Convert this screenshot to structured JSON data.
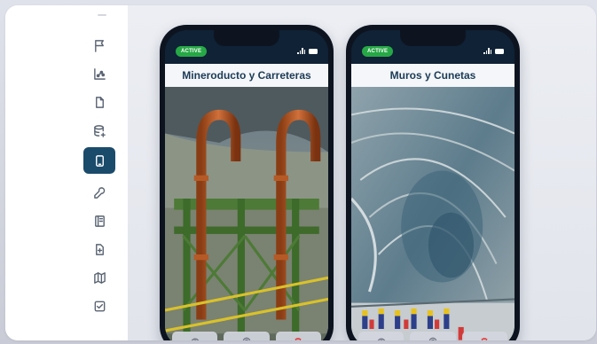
{
  "sidebar": {
    "items": [
      {
        "name": "flag-icon",
        "active": false
      },
      {
        "name": "chart-icon",
        "active": false
      },
      {
        "name": "document-icon",
        "active": false
      },
      {
        "name": "database-add-icon",
        "active": false
      },
      {
        "name": "mobile-icon",
        "active": true
      },
      {
        "name": "wrench-icon",
        "active": false
      },
      {
        "name": "book-icon",
        "active": false
      },
      {
        "name": "file-add-icon",
        "active": false
      },
      {
        "name": "map-icon",
        "active": false
      },
      {
        "name": "checkbox-icon",
        "active": false
      }
    ]
  },
  "phones": [
    {
      "badge": "ACTIVE",
      "title": "Mineroducto y Carreteras",
      "image": "industrial-pipes-photo",
      "actions": [
        "view-icon",
        "settings-icon",
        "delete-icon"
      ]
    },
    {
      "badge": "ACTIVE",
      "title": "Muros y Cunetas",
      "image": "open-pit-mine-photo",
      "actions": [
        "view-icon",
        "settings-icon",
        "delete-icon"
      ]
    }
  ],
  "colors": {
    "accent": "#1b4b6b",
    "badge": "#27a846",
    "title_text": "#1b3b57",
    "delete": "#e14b4b"
  }
}
